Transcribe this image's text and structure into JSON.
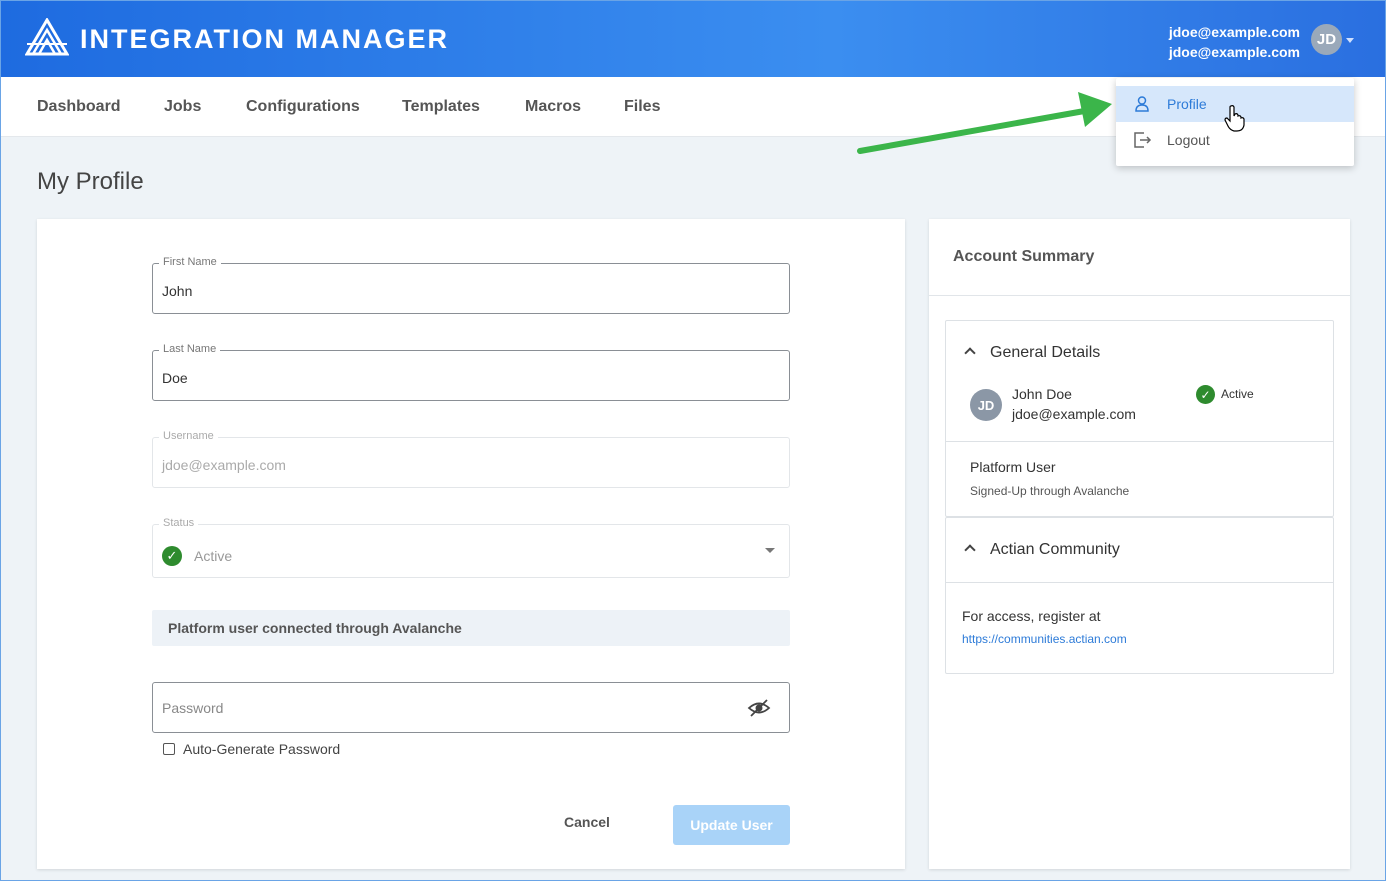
{
  "header": {
    "app_title": "INTEGRATION MANAGER",
    "user_email_primary": "jdoe@example.com",
    "user_email_secondary": "jdoe@example.com",
    "avatar_initials": "JD",
    "logo_icon": "integration-manager-logo-icon",
    "caret_icon": "chevron-down-icon"
  },
  "nav": {
    "items": [
      "Dashboard",
      "Jobs",
      "Configurations",
      "Templates",
      "Macros",
      "Files"
    ]
  },
  "user_menu": {
    "items": [
      {
        "label": "Profile",
        "icon": "user-icon",
        "highlighted": true
      },
      {
        "label": "Logout",
        "icon": "logout-icon",
        "highlighted": false
      }
    ]
  },
  "page": {
    "title": "My Profile"
  },
  "form": {
    "first_name": {
      "label": "First Name",
      "value": "John"
    },
    "last_name": {
      "label": "Last Name",
      "value": "Doe"
    },
    "username": {
      "label": "Username",
      "value": "jdoe@example.com"
    },
    "status": {
      "label": "Status",
      "value": "Active"
    },
    "info_banner": "Platform user connected through Avalanche",
    "password": {
      "placeholder": "Password"
    },
    "auto_generate_label": "Auto-Generate Password",
    "auto_generate_checked": false,
    "cancel_label": "Cancel",
    "update_label": "Update User"
  },
  "summary": {
    "title": "Account Summary",
    "general_details": {
      "title": "General Details",
      "avatar_initials": "JD",
      "name": "John Doe",
      "email": "jdoe@example.com",
      "status": "Active",
      "role": "Platform User",
      "role_detail": "Signed-Up through Avalanche"
    },
    "community": {
      "title": "Actian Community",
      "text": "For access, register at",
      "link": "https://communities.actian.com"
    }
  },
  "colors": {
    "header_gradient_start": "#1e6be0",
    "header_gradient_end": "#3b8ef0",
    "accent_link": "#2d7bd8",
    "active_green": "#2e8b2e",
    "update_button_disabled": "#a9d3f8",
    "menu_highlight": "#d6e7fb",
    "annotation_arrow": "#3bb54a"
  }
}
